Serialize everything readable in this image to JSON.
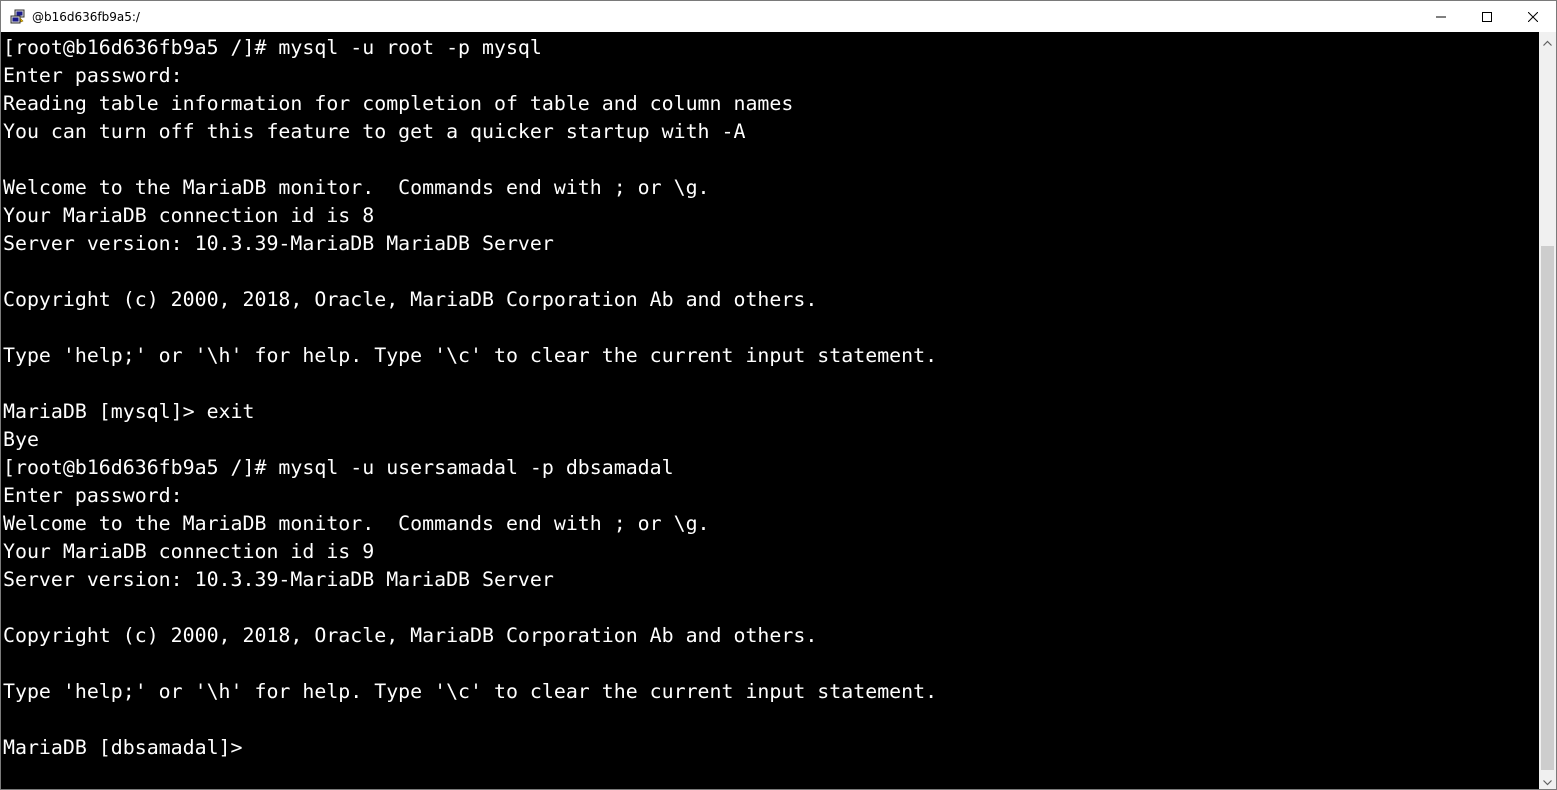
{
  "window": {
    "title": "@b16d636fb9a5:/",
    "icon": "putty-icon",
    "controls": {
      "minimize": "minimize-icon",
      "maximize": "maximize-icon",
      "close": "close-icon"
    }
  },
  "terminal": {
    "lines": [
      "[root@b16d636fb9a5 /]# mysql -u root -p mysql",
      "Enter password:",
      "Reading table information for completion of table and column names",
      "You can turn off this feature to get a quicker startup with -A",
      "",
      "Welcome to the MariaDB monitor.  Commands end with ; or \\g.",
      "Your MariaDB connection id is 8",
      "Server version: 10.3.39-MariaDB MariaDB Server",
      "",
      "Copyright (c) 2000, 2018, Oracle, MariaDB Corporation Ab and others.",
      "",
      "Type 'help;' or '\\h' for help. Type '\\c' to clear the current input statement.",
      "",
      "MariaDB [mysql]> exit",
      "Bye",
      "[root@b16d636fb9a5 /]# mysql -u usersamadal -p dbsamadal",
      "Enter password:",
      "Welcome to the MariaDB monitor.  Commands end with ; or \\g.",
      "Your MariaDB connection id is 9",
      "Server version: 10.3.39-MariaDB MariaDB Server",
      "",
      "Copyright (c) 2000, 2018, Oracle, MariaDB Corporation Ab and others.",
      "",
      "Type 'help;' or '\\h' for help. Type '\\c' to clear the current input statement.",
      "",
      "MariaDB [dbsamadal]>"
    ]
  },
  "colors": {
    "terminal_bg": "#000000",
    "terminal_fg": "#ffffff",
    "titlebar_bg": "#ffffff",
    "scrollbar_track": "#f0f0f0",
    "scrollbar_thumb": "#cdcdcd"
  }
}
